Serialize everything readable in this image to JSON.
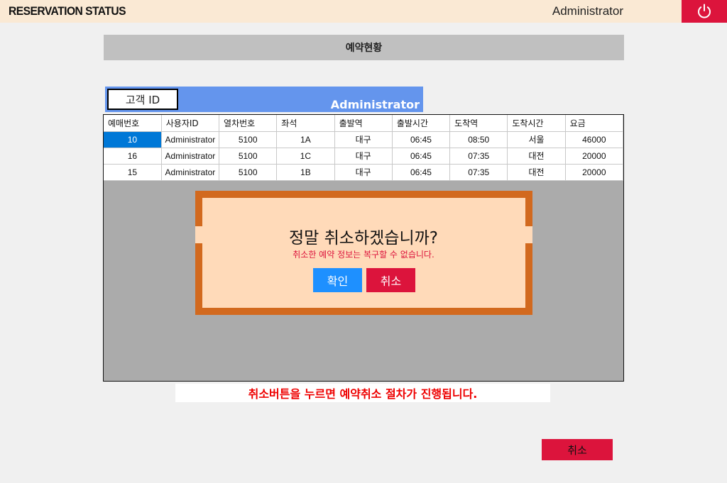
{
  "header": {
    "app_title": "RESERVATION STATUS",
    "user_name": "Administrator",
    "power_icon": "power-icon",
    "accent_color": "#dc143c"
  },
  "page": {
    "title": "예약현황"
  },
  "user_bar": {
    "customer_id_button": "고객 ID",
    "user_name": "Administrator",
    "bar_color": "#6495ed"
  },
  "table": {
    "columns": [
      "예매번호",
      "사용자ID",
      "열차번호",
      "좌석",
      "출발역",
      "출발시간",
      "도착역",
      "도착시간",
      "요금"
    ],
    "rows": [
      [
        "10",
        "Administrator",
        "5100",
        "1A",
        "대구",
        "06:45",
        "08:50",
        "서울",
        "46000"
      ],
      [
        "16",
        "Administrator",
        "5100",
        "1C",
        "대구",
        "06:45",
        "07:35",
        "대전",
        "20000"
      ],
      [
        "15",
        "Administrator",
        "5100",
        "1B",
        "대구",
        "06:45",
        "07:35",
        "대전",
        "20000"
      ]
    ],
    "selected_color": "#0078d7"
  },
  "dialog": {
    "title": "정말 취소하겠습니까?",
    "message": "취소한 예약 정보는 복구할 수 없습니다.",
    "confirm_label": "확인",
    "cancel_label": "취소"
  },
  "notice": "취소버튼을 누르면 예약취소 절차가 진행됩니다.",
  "footer": {
    "cancel_label": "취소"
  }
}
